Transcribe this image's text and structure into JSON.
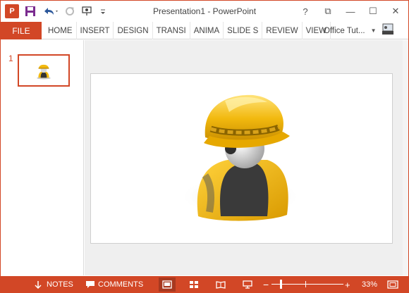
{
  "window": {
    "title": "Presentation1 - PowerPoint",
    "app_logo": "P"
  },
  "qat": {
    "save_icon": "save-icon",
    "undo_icon": "undo-icon",
    "redo_icon": "redo-icon",
    "present_icon": "start-from-beginning-icon",
    "customize_icon": "customize-qat-icon"
  },
  "window_controls": [
    "?",
    "⧉",
    "—",
    "☐",
    "✕"
  ],
  "ribbon": {
    "file_label": "FILE",
    "tabs": [
      "HOME",
      "INSERT",
      "DESIGN",
      "TRANSI",
      "ANIMA",
      "SLIDE S",
      "REVIEW",
      "VIEW"
    ],
    "account_label": "Office Tut..."
  },
  "thumbnails": [
    {
      "number": "1"
    }
  ],
  "statusbar": {
    "notes_label": "NOTES",
    "comments_label": "COMMENTS",
    "zoom_label": "33%",
    "zoom_minus": "−",
    "zoom_plus": "+"
  },
  "colors": {
    "accent": "#d24726",
    "helmet": "#f2b90f",
    "body_dark": "#3a3a3a"
  }
}
